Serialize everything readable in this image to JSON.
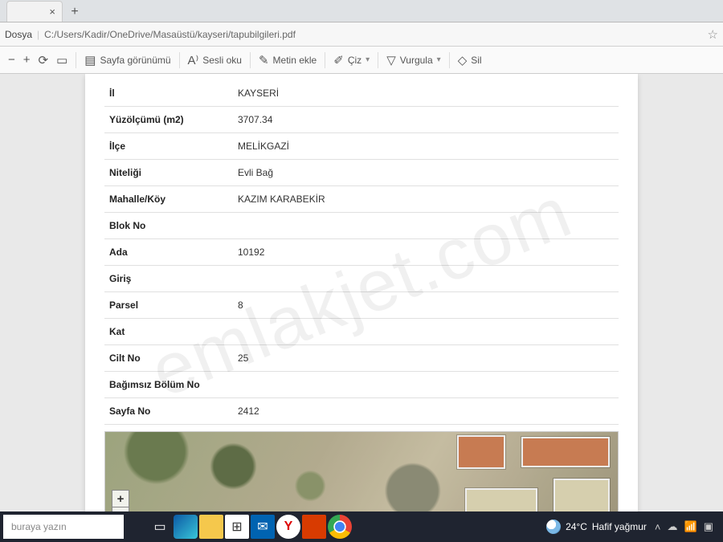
{
  "tab": {
    "close": "×",
    "new": "+"
  },
  "address": {
    "label": "Dosya",
    "path": "C:/Users/Kadir/OneDrive/Masaüstü/kayseri/tapubilgileri.pdf"
  },
  "pdf_toolbar": {
    "zoom_out": "−",
    "zoom_in": "+",
    "page_view": "Sayfa görünümü",
    "read_aloud": "Sesli oku",
    "add_text": "Metin ekle",
    "draw": "Çiz",
    "highlight": "Vurgula",
    "erase": "Sil"
  },
  "deed": {
    "rows": [
      {
        "k": "İl",
        "v": "KAYSERİ"
      },
      {
        "k": "Yüzölçümü (m2)",
        "v": "3707.34"
      },
      {
        "k": "İlçe",
        "v": "MELİKGAZİ"
      },
      {
        "k": "Niteliği",
        "v": "Evli Bağ"
      },
      {
        "k": "Mahalle/Köy",
        "v": "KAZIM KARABEKİR"
      },
      {
        "k": "Blok No",
        "v": ""
      },
      {
        "k": "Ada",
        "v": "10192"
      },
      {
        "k": "Giriş",
        "v": ""
      },
      {
        "k": "Parsel",
        "v": "8"
      },
      {
        "k": "Kat",
        "v": ""
      },
      {
        "k": "Cilt No",
        "v": "25"
      },
      {
        "k": "Bağımsız Bölüm No",
        "v": ""
      },
      {
        "k": "Sayfa No",
        "v": "2412"
      }
    ]
  },
  "watermark": "emlakjet.com",
  "map": {
    "zoom_in": "+",
    "zoom_out": "−"
  },
  "taskbar": {
    "search_placeholder": "buraya yazın",
    "weather_temp": "24°C",
    "weather_desc": "Hafif yağmur",
    "tray_chevron": "˄"
  }
}
